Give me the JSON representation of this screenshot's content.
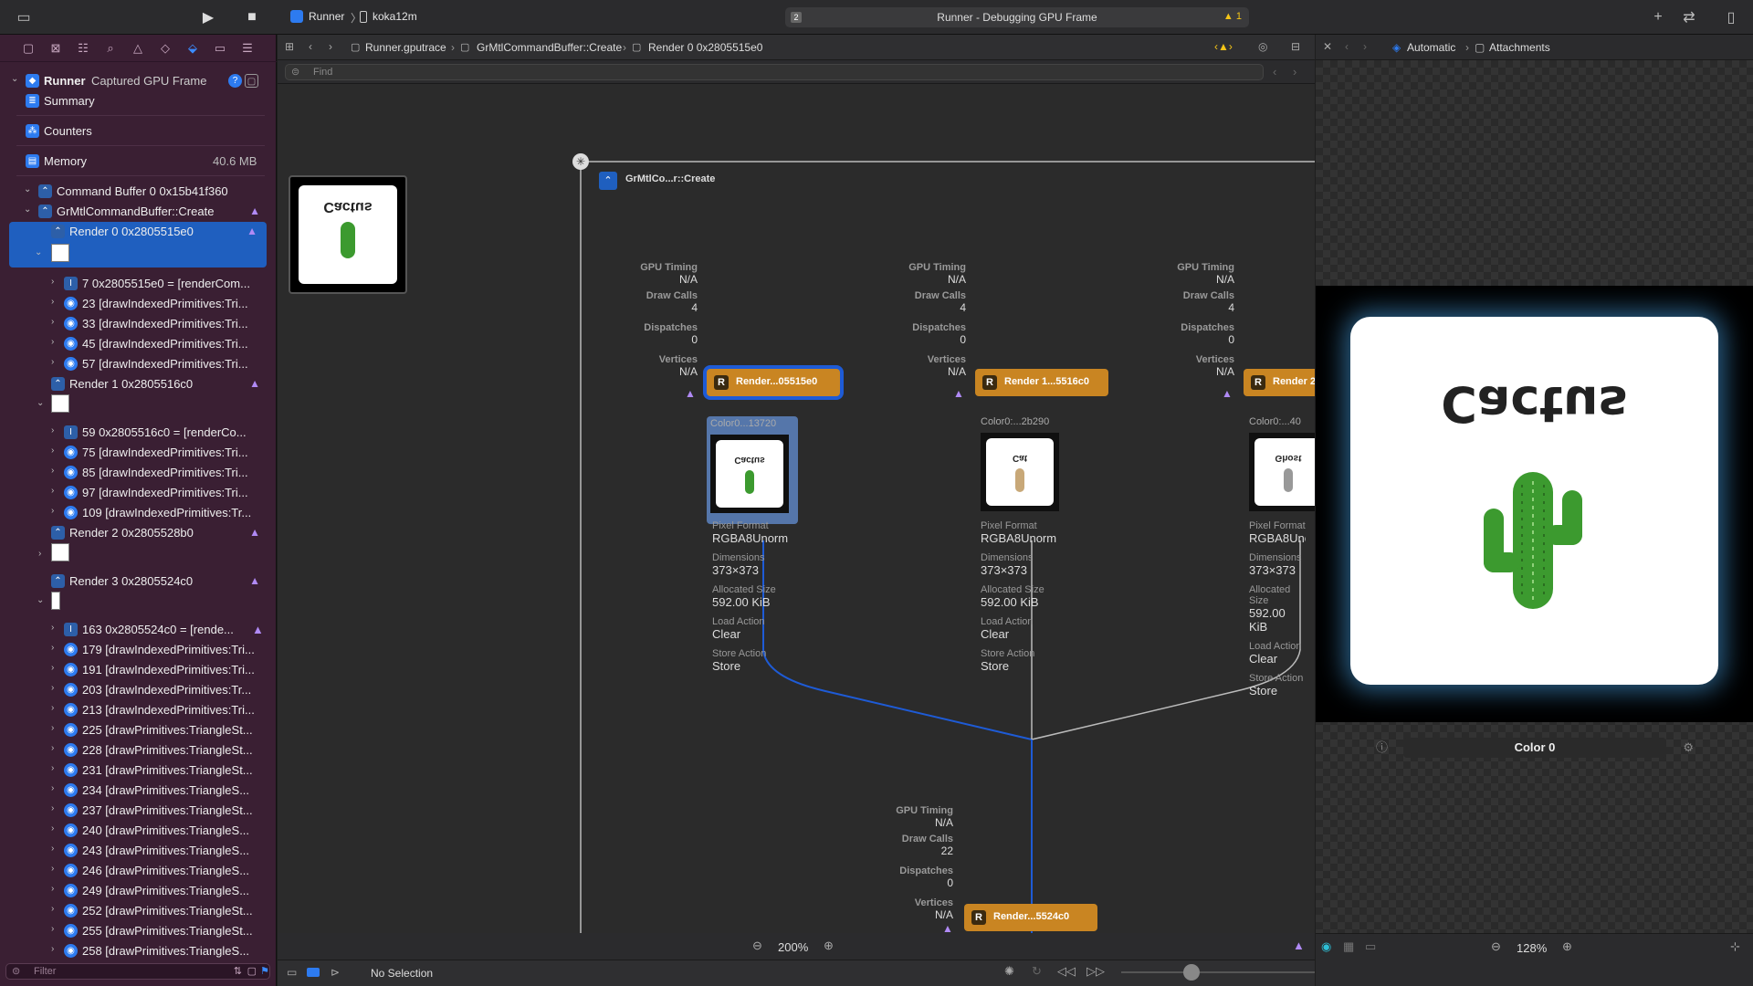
{
  "toolbar": {
    "scheme": "Runner",
    "device": "koka12m",
    "activity_number": "2",
    "activity_text": "Runner - Debugging GPU Frame",
    "warning_count": "1"
  },
  "navigator": {
    "root_title": "Runner",
    "root_subtitle": "Captured GPU Frame",
    "summary": "Summary",
    "counters": "Counters",
    "memory": "Memory",
    "memory_value": "40.6 MB",
    "command_buffer": "Command Buffer 0 0x15b41f360",
    "grmtl": "GrMtlCommandBuffer::Create",
    "render0": "Render 0 0x2805515e0",
    "render0_items": [
      "7 0x2805515e0 = [renderCom...",
      "23 [drawIndexedPrimitives:Tri...",
      "33 [drawIndexedPrimitives:Tri...",
      "45 [drawIndexedPrimitives:Tri...",
      "57 [drawIndexedPrimitives:Tri..."
    ],
    "render1": "Render 1 0x2805516c0",
    "render1_items": [
      "59 0x2805516c0 = [renderCo...",
      "75 [drawIndexedPrimitives:Tri...",
      "85 [drawIndexedPrimitives:Tri...",
      "97 [drawIndexedPrimitives:Tri...",
      "109 [drawIndexedPrimitives:Tr..."
    ],
    "render2": "Render 2 0x2805528b0",
    "render3": "Render 3 0x2805524c0",
    "render3_items": [
      "163 0x2805524c0 = [rende...",
      "179 [drawIndexedPrimitives:Tri...",
      "191 [drawIndexedPrimitives:Tri...",
      "203 [drawIndexedPrimitives:Tr...",
      "213 [drawIndexedPrimitives:Tri...",
      "225 [drawPrimitives:TriangleSt...",
      "228 [drawPrimitives:TriangleSt...",
      "231 [drawPrimitives:TriangleSt...",
      "234 [drawPrimitives:TriangleS...",
      "237 [drawPrimitives:TriangleSt...",
      "240 [drawPrimitives:TriangleS...",
      "243 [drawPrimitives:TriangleS...",
      "246 [drawPrimitives:TriangleS...",
      "249 [drawPrimitives:TriangleS...",
      "252 [drawPrimitives:TriangleSt...",
      "255 [drawPrimitives:TriangleSt...",
      "258 [drawPrimitives:TriangleS..."
    ],
    "filter_placeholder": "Filter"
  },
  "editor": {
    "breadcrumb": [
      "Runner.gputrace",
      "GrMtlCommandBuffer::Create",
      "Render 0 0x2805515e0"
    ],
    "find_placeholder": "Find",
    "group_title": "GrMtlCo...r::Create",
    "thumb_text": "Cactus",
    "stat_labels": {
      "gpu": "GPU Timing",
      "draw": "Draw Calls",
      "disp": "Dispatches",
      "vert": "Vertices"
    },
    "columns": [
      {
        "gpu": "N/A",
        "draw": "4",
        "disp": "0",
        "vert": "N/A",
        "node": "Render...05515e0",
        "att": "Color0...13720",
        "thumb": "Cactus"
      },
      {
        "gpu": "N/A",
        "draw": "4",
        "disp": "0",
        "vert": "N/A",
        "node": "Render 1...5516c0",
        "att": "Color0:...2b290",
        "thumb": "Cat"
      },
      {
        "gpu": "N/A",
        "draw": "4",
        "disp": "0",
        "vert": "N/A",
        "node": "Render 2...",
        "att": "Color0:...40",
        "thumb": "Ghost"
      }
    ],
    "att_labels": {
      "pf": "Pixel Format",
      "dim": "Dimensions",
      "alloc": "Allocated Size",
      "load": "Load Action",
      "store": "Store Action"
    },
    "att_values": {
      "pf": "RGBA8Unorm",
      "dim": "373×373",
      "alloc": "592.00 KiB",
      "load": "Clear",
      "store": "Store"
    },
    "bottom_node": {
      "gpu": "N/A",
      "draw": "22",
      "disp": "0",
      "vert": "N/A",
      "node": "Render...5524c0"
    },
    "zoom": "200%",
    "selection": "No Selection"
  },
  "inspector": {
    "mode": "Automatic",
    "section": "Attachments",
    "preview_text": "Cactus",
    "color_label": "Color 0",
    "zoom": "128%"
  },
  "colors": {
    "navigator_bg": "#3a1f33",
    "selection": "#1f5fbf",
    "render_node": "#c98522",
    "edge_blue": "#1e5bd6"
  }
}
